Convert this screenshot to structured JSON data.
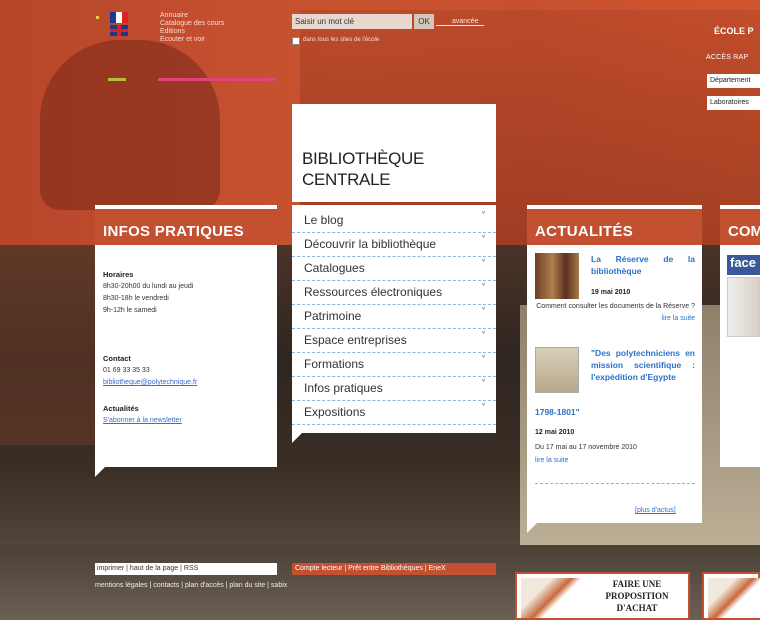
{
  "language": {
    "fr_flag": "french-flag-icon",
    "en_flag": "uk-flag-icon"
  },
  "topnav": [
    "Annuaire",
    "Catalogue des cours",
    "Editions",
    "Ecouter et voir"
  ],
  "search": {
    "placeholder": "Saisir un mot clé",
    "ok_label": "OK",
    "advanced_label": "avancée",
    "checkbox_label": "dans tous les sites de l'école"
  },
  "right_header": {
    "school": "ÉCOLE P",
    "acces": "ACCÈS RAP",
    "dept1": "Département",
    "dept2": "Laboratoires"
  },
  "title": {
    "line1": "BIBLIOTHÈQUE",
    "line2": "CENTRALE"
  },
  "menu": [
    {
      "label": "Le blog"
    },
    {
      "label": "Découvrir la bibliothèque"
    },
    {
      "label": "Catalogues"
    },
    {
      "label": "Ressources électroniques"
    },
    {
      "label": "Patrimoine"
    },
    {
      "label": "Espace entreprises"
    },
    {
      "label": "Formations"
    },
    {
      "label": "Infos pratiques"
    },
    {
      "label": "Expositions"
    }
  ],
  "chevron": "˅",
  "infos": {
    "header": "INFOS PRATIQUES",
    "horaires_title": "Horaires",
    "horaires": [
      "8h30-20h00 du lundi au jeudi",
      "8h30-18h le vendredi",
      "9h-12h le samedi"
    ],
    "contact_title": "Contact",
    "phone": "01 69 33 35 33",
    "email": "bibliotheque@polytechnique.fr",
    "actualites_title": "Actualités",
    "newsletter": "S'abonner à la newsletter"
  },
  "actu": {
    "header": "ACTUALITÉS",
    "item1": {
      "title": "La Réserve de la bibliothèque",
      "date": "19 mai 2010",
      "text": "Comment consulter les documents de la Réserve ?",
      "link": "lire la suite"
    },
    "item2": {
      "title": "\"Des polytechniciens en mission scientifique : l'expédition d'Egypte",
      "title_cont": "1798-1801\"",
      "date": "12 mai 2010",
      "text": "Du 17 mai au 17 novembre 2010",
      "link": "lire la suite"
    },
    "more": "[plus d'actus]"
  },
  "com": {
    "header": "COM",
    "fb": "face"
  },
  "footer": {
    "bar1": "imprimer | haut de la page | RSS",
    "bar2": "Compte lecteur | Prêt entre Bibliothèques | EneX",
    "bar3": "mentions légales | contacts | plan d'accès | plan du site | sabix"
  },
  "proposition": {
    "line1": "FAIRE UNE",
    "line2": "PROPOSITION",
    "line3": "D'ACHAT"
  }
}
